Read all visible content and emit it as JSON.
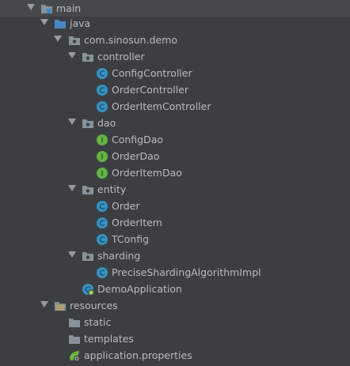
{
  "tree": {
    "main": "main",
    "java": "java",
    "package": "com.sinosun.demo",
    "controller": "controller",
    "ConfigController": "ConfigController",
    "OrderController": "OrderController",
    "OrderItemController": "OrderItemController",
    "dao": "dao",
    "ConfigDao": "ConfigDao",
    "OrderDao": "OrderDao",
    "OrderItemDao": "OrderItemDao",
    "entity": "entity",
    "Order": "Order",
    "OrderItem": "OrderItem",
    "TConfig": "TConfig",
    "sharding": "sharding",
    "PreciseShardingAlgorithmImpl": "PreciseShardingAlgorithmImpl",
    "DemoApplication": "DemoApplication",
    "resources": "resources",
    "static": "static",
    "templates": "templates",
    "application_properties": "application.properties"
  },
  "icons": {
    "class_color": "#3592c4",
    "interface_color": "#62b543",
    "folder_color": "#87939a",
    "source_folder_color": "#4a86c7",
    "spring_color": "#6db33f"
  }
}
